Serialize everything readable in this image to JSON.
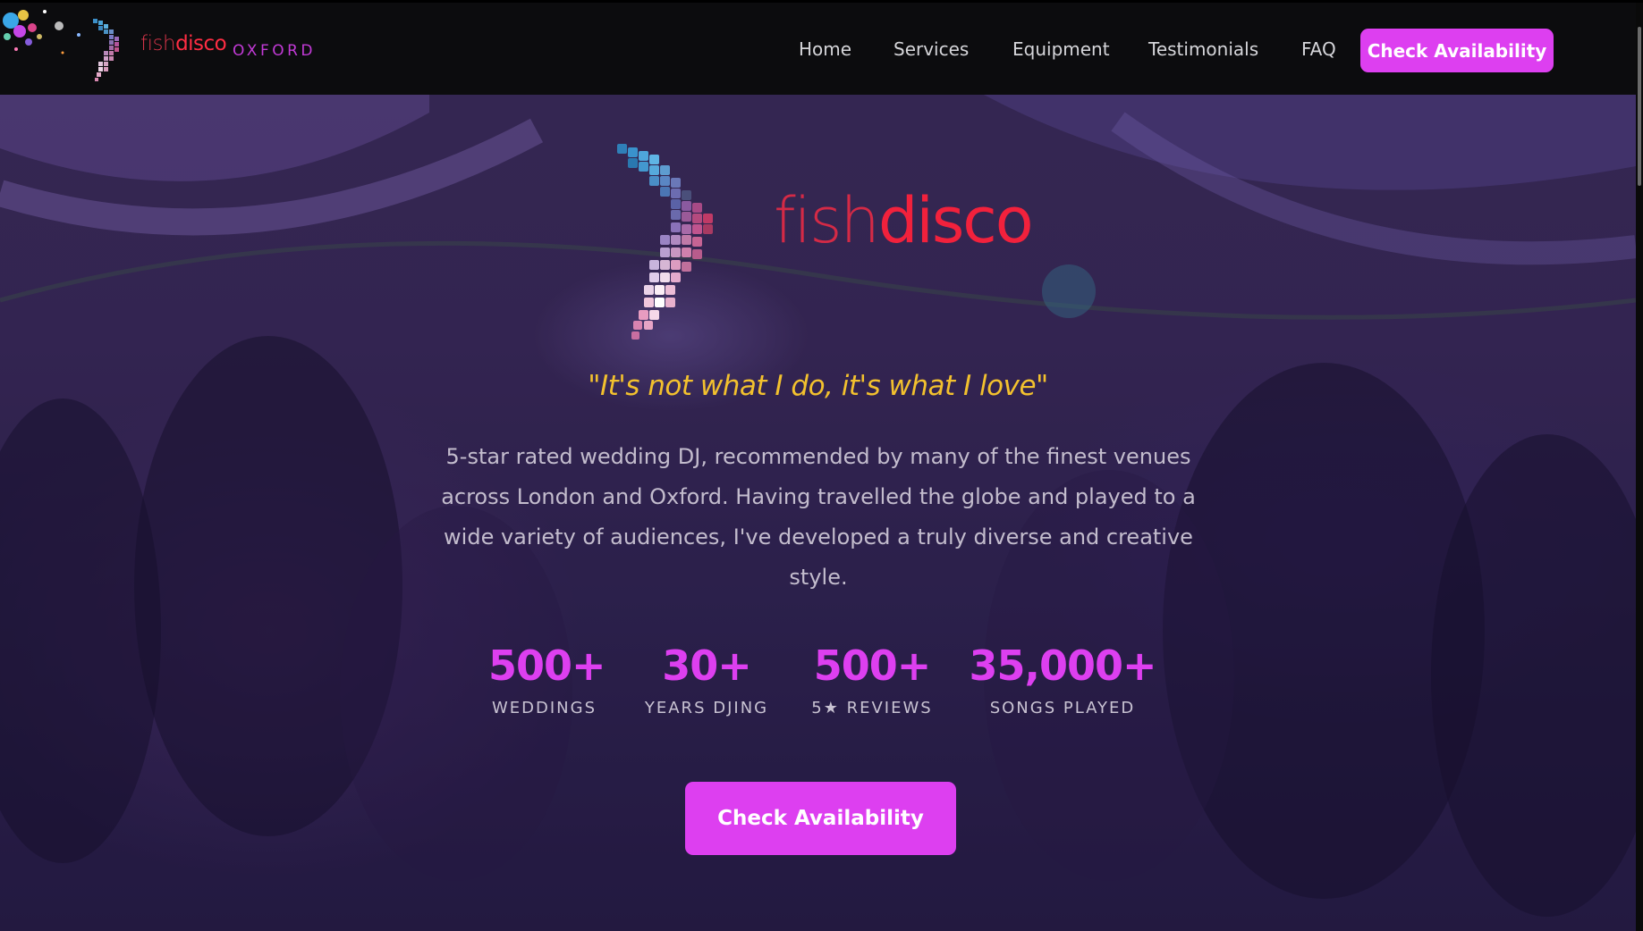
{
  "nav": {
    "brand": {
      "word_light": "fish",
      "word_bold": "disco",
      "city": "OXFORD"
    },
    "links": [
      {
        "label": "Home"
      },
      {
        "label": "Services"
      },
      {
        "label": "Equipment"
      },
      {
        "label": "Testimonials"
      },
      {
        "label": "FAQ"
      }
    ],
    "cta_label": "Check Availability"
  },
  "hero": {
    "logo": {
      "word_light": "fish",
      "word_bold": "disco"
    },
    "tagline": "\"It's not what I do, it's what I love\"",
    "intro": "5-star rated wedding DJ, recommended by many of the finest venues across London and Oxford. Having travelled the globe and played to a wide variety of audiences, I've developed a truly diverse and creative style.",
    "stats": [
      {
        "value": "500+",
        "label": "WEDDINGS"
      },
      {
        "value": "30+",
        "label": "YEARS DJING"
      },
      {
        "value": "500+",
        "label": "5★ REVIEWS"
      },
      {
        "value": "35,000+",
        "label": "SONGS PLAYED"
      }
    ],
    "cta_label": "Check Availability"
  },
  "colors": {
    "accent": "#dd3ff0",
    "brand_red": "#f2213c",
    "tagline_yellow": "#f3c12e",
    "nav_bg": "#0c0c0e"
  },
  "icons": [
    "fishdisco-logo-mark",
    "sparkles-decoration"
  ]
}
